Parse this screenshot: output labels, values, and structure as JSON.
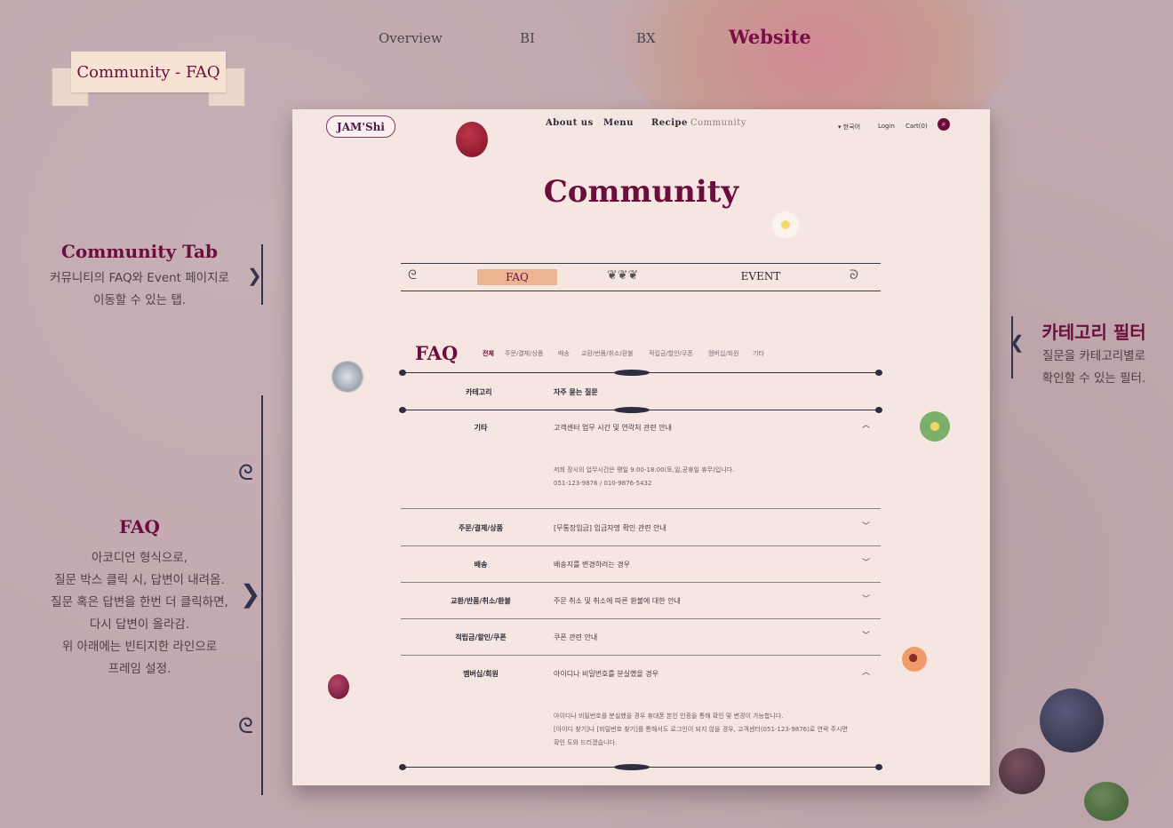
{
  "topnav": {
    "items": [
      {
        "label": "Overview"
      },
      {
        "label": "BI"
      },
      {
        "label": "BX"
      },
      {
        "label": "Website"
      }
    ],
    "active": "Website"
  },
  "ribbon_title": "Community - FAQ",
  "annotations": {
    "tab": {
      "title": "Community Tab",
      "lines": [
        "커뮤니티의 FAQ와 Event 페이지로",
        "이동할 수 있는 탭."
      ]
    },
    "faq": {
      "title": "FAQ",
      "lines": [
        "아코디언 형식으로,",
        "질문 박스 클릭 시, 답변이 내려옴.",
        "질문 혹은 답변을 한번 더 클릭하면,",
        "다시 답변이 올라감.",
        "위 아래에는 빈티지한 라인으로",
        "프레임 설정."
      ]
    },
    "filter": {
      "title": "카테고리 필터",
      "lines": [
        "질문을 카테고리별로",
        "확인할 수 있는 필터."
      ]
    }
  },
  "site": {
    "logo_text": "JAM'Shi",
    "nav": [
      "About us",
      "Menu",
      "Recipe",
      "Community"
    ],
    "nav_active": "Community",
    "language": "▾ 한국어",
    "login": "Login",
    "cart": "Cart(0)",
    "page_title": "Community",
    "tabs": {
      "faq": "FAQ",
      "event": "EVENT"
    },
    "faq_heading": "FAQ",
    "filters": [
      "전체",
      "주문/결제/상품",
      "배송",
      "교환/반품/취소/환불",
      "적립금/할인/쿠폰",
      "멤버십/회원",
      "기타"
    ],
    "filter_active": "전체",
    "columns": {
      "category": "카테고리",
      "question": "자주 묻는 질문"
    },
    "rows": [
      {
        "category": "기타",
        "question": "고객센터 업무 시간 및 연락처 관련 안내",
        "chevron": "︿"
      },
      {
        "category": "주문/결제/상품",
        "question": "[무통장입금] 입금자명 확인 관련 안내",
        "chevron": "﹀"
      },
      {
        "category": "배송",
        "question": "배송지를 변경하려는 경우",
        "chevron": "﹀"
      },
      {
        "category": "교환/반품/취소/환불",
        "question": "주문 취소 및 취소에 따른 환불에 대한 안내",
        "chevron": "﹀"
      },
      {
        "category": "적립금/할인/쿠폰",
        "question": "쿠폰 관련 안내",
        "chevron": "﹀"
      },
      {
        "category": "멤버십/회원",
        "question": "아이디나 비밀번호를 분실했을 경우",
        "chevron": "︿"
      }
    ],
    "answer1": [
      "저희 장시의 업무시간은 평일 9:00-18:00(토,일,공휴일 휴무)입니다.",
      "051-123-9876 / 010-9876-5432"
    ],
    "answer2": [
      "아이디나 비밀번호를 분실했을 경우 휴대폰 본인 인증을 통해 확인 및 변경이 가능합니다.",
      "[아이디 찾기]나 [비밀번호 찾기]를 통해서도 로그인이 되지 않을 경우, 고객센터(051-123-9876)로 연락 주시면",
      "확인 도와 드리겠습니다."
    ]
  },
  "colors": {
    "background": "#c2a9af",
    "accent": "#6c0d3d",
    "paper": "#f6e6e1",
    "tab_highlight": "#ebb593"
  }
}
